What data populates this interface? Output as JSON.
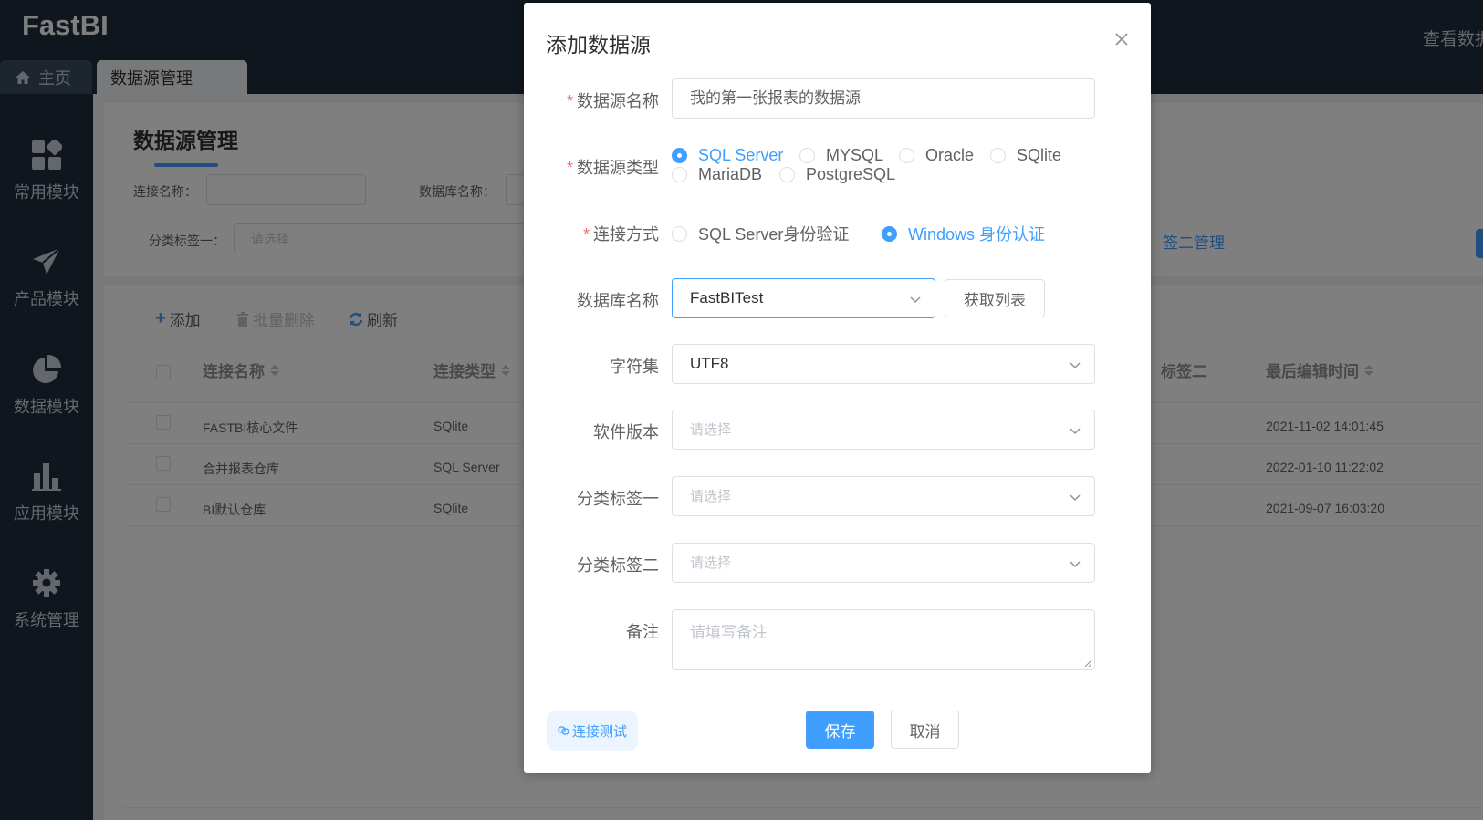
{
  "app": {
    "logo": "FastBI",
    "top_right_text": "查看数据",
    "tabs": [
      {
        "label": "主页",
        "icon": "home-icon"
      },
      {
        "label": "数据源管理"
      }
    ],
    "sidebar": [
      {
        "label": "常用模块",
        "icon": "apps-icon"
      },
      {
        "label": "产品模块",
        "icon": "paper-plane-icon"
      },
      {
        "label": "数据模块",
        "icon": "pie-chart-icon"
      },
      {
        "label": "应用模块",
        "icon": "bar-chart-icon"
      },
      {
        "label": "系统管理",
        "icon": "gear-icon"
      }
    ]
  },
  "page": {
    "title": "数据源管理",
    "filters": {
      "connection_name_label": "连接名称：",
      "database_name_label": "数据库名称：",
      "category1_label": "分类标签一：",
      "category1_placeholder": "请选择",
      "tag2_manage_link": "签二管理"
    },
    "toolbar": {
      "add": "添加",
      "batch_delete": "批量删除",
      "refresh": "刷新"
    },
    "table": {
      "headers": [
        "连接名称",
        "连接类型",
        "标签二",
        "最后编辑时间"
      ],
      "rows": [
        {
          "name": "FASTBI核心文件",
          "type": "SQlite",
          "time": "2021-11-02 14:01:45"
        },
        {
          "name": "合并报表仓库",
          "type": "SQL Server",
          "time": "2022-01-10 11:22:02"
        },
        {
          "name": "BI默认仓库",
          "type": "SQlite",
          "time": "2021-09-07 16:03:20"
        }
      ]
    }
  },
  "modal": {
    "title": "添加数据源",
    "fields": {
      "name": {
        "label": "数据源名称",
        "value": "我的第一张报表的数据源"
      },
      "type": {
        "label": "数据源类型",
        "options": [
          "SQL Server",
          "MYSQL",
          "Oracle",
          "SQlite",
          "MariaDB",
          "PostgreSQL"
        ],
        "selected": "SQL Server"
      },
      "auth": {
        "label": "连接方式",
        "options": [
          "SQL Server身份验证",
          "Windows 身份认证"
        ],
        "selected": "Windows 身份认证"
      },
      "database": {
        "label": "数据库名称",
        "value": "FastBITest",
        "fetch_button": "获取列表"
      },
      "charset": {
        "label": "字符集",
        "value": "UTF8"
      },
      "version": {
        "label": "软件版本",
        "placeholder": "请选择"
      },
      "category1": {
        "label": "分类标签一",
        "placeholder": "请选择"
      },
      "category2": {
        "label": "分类标签二",
        "placeholder": "请选择"
      },
      "remark": {
        "label": "备注",
        "placeholder": "请填写备注"
      }
    },
    "buttons": {
      "test": "连接测试",
      "save": "保存",
      "cancel": "取消"
    }
  },
  "colors": {
    "primary": "#409eff",
    "sidebar_bg": "#1f2d3d",
    "required": "#f56c6c"
  }
}
